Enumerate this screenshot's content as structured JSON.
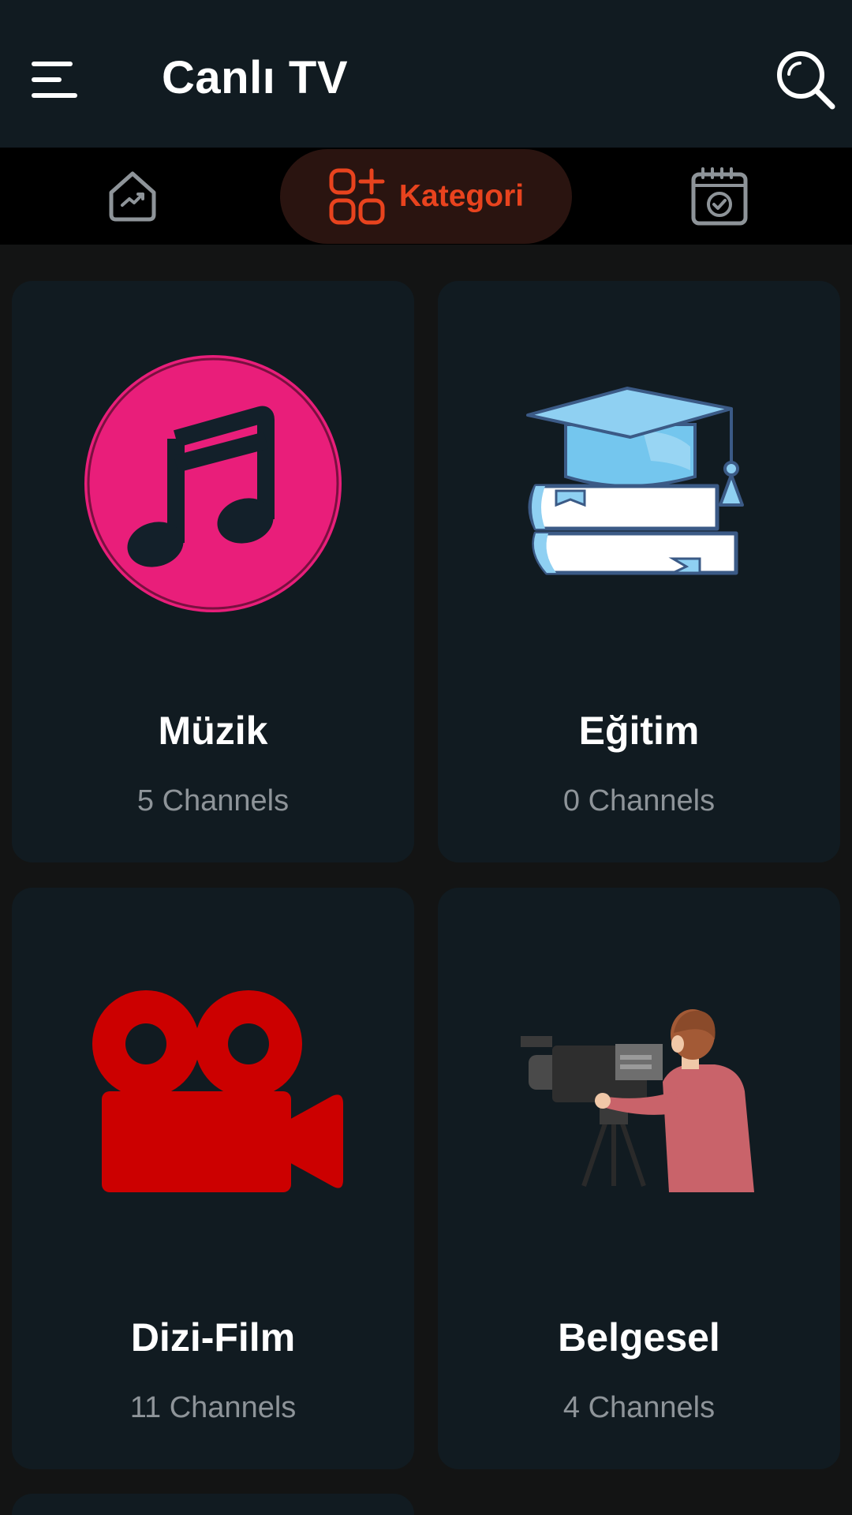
{
  "header": {
    "title": "Canlı TV",
    "menu_icon": "menu-icon",
    "search_icon": "search-icon"
  },
  "tabs": [
    {
      "id": "trending",
      "icon": "trending-icon",
      "label": "",
      "active": false
    },
    {
      "id": "category",
      "icon": "category-grid-icon",
      "label": "Kategori",
      "active": true
    },
    {
      "id": "schedule",
      "icon": "calendar-check-icon",
      "label": "",
      "active": false
    }
  ],
  "colors": {
    "accent": "#e8431e",
    "background": "#131414",
    "card": "#111b21",
    "music_pink": "#e91e7a",
    "film_red": "#cc0000"
  },
  "categories": [
    {
      "title": "Müzik",
      "subtitle": "5 Channels",
      "icon": "music-note-icon"
    },
    {
      "title": "Eğitim",
      "subtitle": "0 Channels",
      "icon": "graduation-books-icon"
    },
    {
      "title": "Dizi-Film",
      "subtitle": "11 Channels",
      "icon": "movie-camera-icon"
    },
    {
      "title": "Belgesel",
      "subtitle": "4 Channels",
      "icon": "cameraman-icon"
    }
  ]
}
